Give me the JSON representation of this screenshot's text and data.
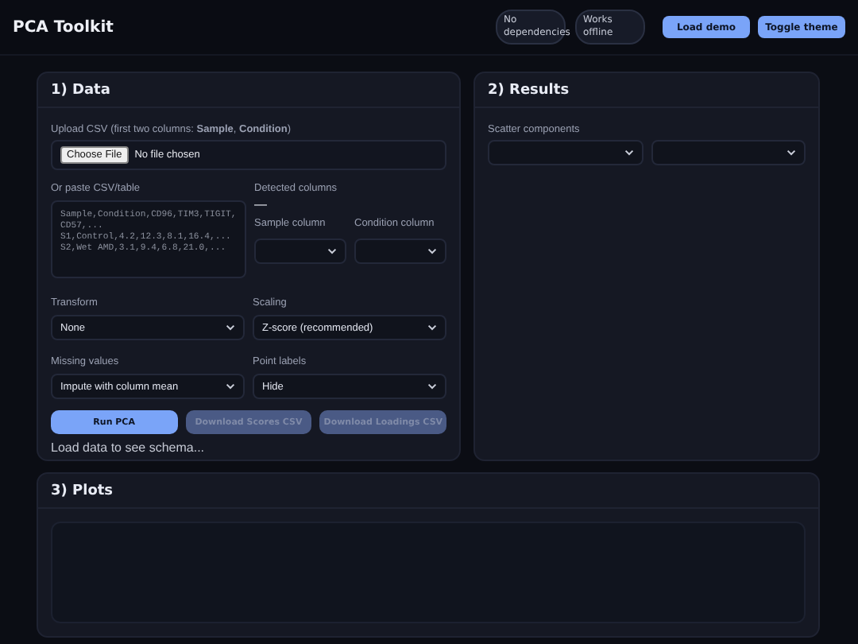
{
  "header": {
    "title": "PCA Toolkit",
    "badges": [
      "No dependencies",
      "Works offline"
    ],
    "buttons": [
      "Load demo",
      "Toggle theme"
    ]
  },
  "data_panel": {
    "title": "1) Data",
    "upload": {
      "label": "Upload CSV (first two columns: **Sample**, **Condition**)",
      "button": "Choose File",
      "status": "No file chosen"
    },
    "paste": {
      "label": "Or paste CSV/table",
      "placeholder": "Sample,Condition,CD96,TIM3,TIGIT,CD57,...\nS1,Control,4.2,12.3,8.1,16.4,...\nS2,Wet AMD,3.1,9.4,6.8,21.0,..."
    },
    "detected": {
      "label": "Detected columns",
      "value": "—"
    },
    "column_selects": [
      {
        "label": "Sample column"
      },
      {
        "label": "Condition column"
      }
    ],
    "options": [
      {
        "label": "Transform",
        "value": "None"
      },
      {
        "label": "Scaling",
        "value": "Z-score (recommended)"
      },
      {
        "label": "Missing values",
        "value": "Impute with column mean"
      },
      {
        "label": "Point labels",
        "value": "Hide"
      }
    ],
    "actions": [
      {
        "label": "Run PCA",
        "disabled": false
      },
      {
        "label": "Download Scores CSV",
        "disabled": true
      },
      {
        "label": "Download Loadings CSV",
        "disabled": true
      }
    ],
    "schema_status": "Load data to see schema..."
  },
  "results_panel": {
    "title": "2) Results",
    "scatter": {
      "label": "Scatter components"
    }
  },
  "plots_panel": {
    "title": "3) Plots"
  }
}
